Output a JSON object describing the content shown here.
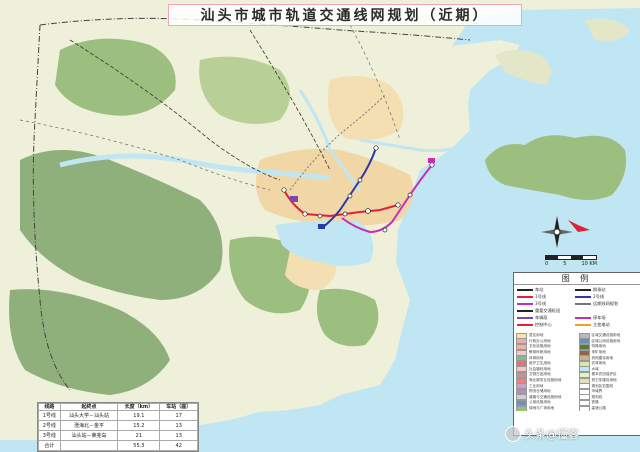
{
  "title": "汕头市城市轨道交通线网规划（近期）",
  "colors": {
    "sea": "#bfe6f2",
    "land": "#eef0d9",
    "mountain": "#8fb07a",
    "urban": "#f2d7a6",
    "river": "#bfe6f2",
    "line1": "#e0213a",
    "line2": "#2b3aa8",
    "line3": "#c22fb8",
    "boundary": "#444444"
  },
  "legend": {
    "title": "图 例",
    "lines": [
      {
        "label": "车站",
        "label2": "换乘站",
        "color": "#222222",
        "icon": "station-circle-icon"
      },
      {
        "label": "1号线",
        "label2": "2号线",
        "color": "#e0213a",
        "color2": "#2b3aa8"
      },
      {
        "label": "3号线",
        "label2": "远期线网规划",
        "color": "#c22fb8",
        "color2": "#777777"
      },
      {
        "label": "重要交通枢纽",
        "label2": "",
        "color": "#222222",
        "icon": "hub-square-icon"
      },
      {
        "label": "车辆段",
        "label2": "停车场",
        "color": "#7a4aa8",
        "color2": "#c22fb8",
        "icon": "depot-icon"
      },
      {
        "label": "控制中心",
        "label2": "主变电站",
        "color": "#e0213a",
        "color2": "#f0a020",
        "icon": "control-center-icon"
      }
    ],
    "landuse": [
      {
        "label": "居住用地",
        "color": "#f7e79a"
      },
      {
        "label": "区域交通设施用地",
        "color": "#b8b8b8"
      },
      {
        "label": "行政办公用地",
        "color": "#f0a8b8"
      },
      {
        "label": "区域公用设施用地",
        "color": "#6a8fb0"
      },
      {
        "label": "文化设施用地",
        "color": "#f4b0a0"
      },
      {
        "label": "特殊用地",
        "color": "#5a7a3a"
      },
      {
        "label": "教育科研用地",
        "color": "#f5c6d6"
      },
      {
        "label": "采矿用地",
        "color": "#8a6a4a"
      },
      {
        "label": "体育用地",
        "color": "#7ac08a"
      },
      {
        "label": "其他建设用地",
        "color": "#c8b090"
      },
      {
        "label": "医疗卫生用地",
        "color": "#e87070"
      },
      {
        "label": "农林用地",
        "color": "#d8e8a8"
      },
      {
        "label": "社会福利用地",
        "color": "#f0c8c8"
      },
      {
        "label": "水域",
        "color": "#bfe6f2"
      },
      {
        "label": "文物古迹用地",
        "color": "#c89090"
      },
      {
        "label": "基本农田保护区",
        "color": "#e8f0c0"
      },
      {
        "label": "商业服务业设施用地",
        "color": "#f08080"
      },
      {
        "label": "其它非建设用地",
        "color": "#e0e0c0"
      },
      {
        "label": "工业用地",
        "color": "#c8a0c8"
      },
      {
        "label": "规划区范围线",
        "color": "#ffffff"
      },
      {
        "label": "物流仓储用地",
        "color": "#b090c0"
      },
      {
        "label": "市域界",
        "color": "#ffffff"
      },
      {
        "label": "道路与交通设施用地",
        "color": "#d0d0d0"
      },
      {
        "label": "规划线",
        "color": "#ffffff"
      },
      {
        "label": "公用设施用地",
        "color": "#7090c0"
      },
      {
        "label": "铁路",
        "color": "#ffffff"
      },
      {
        "label": "绿地与广场用地",
        "color": "#8cc878"
      },
      {
        "label": "高速公路",
        "color": "#ffffff"
      }
    ]
  },
  "table": {
    "headers": [
      "线路",
      "起终点",
      "长度（km）",
      "车站（座）"
    ],
    "rows": [
      [
        "1号线",
        "汕头大学－汕头站",
        "19.1",
        "17"
      ],
      [
        "2号线",
        "澄海北－金平",
        "15.2",
        "13"
      ],
      [
        "3号线",
        "汕头站－莱芜岛",
        "21",
        "13"
      ],
      [
        "合计",
        "",
        "55.3",
        "42"
      ]
    ]
  },
  "scale": {
    "labels": [
      "0",
      "5",
      "10 KM"
    ]
  },
  "watermark": "头条@懂客"
}
